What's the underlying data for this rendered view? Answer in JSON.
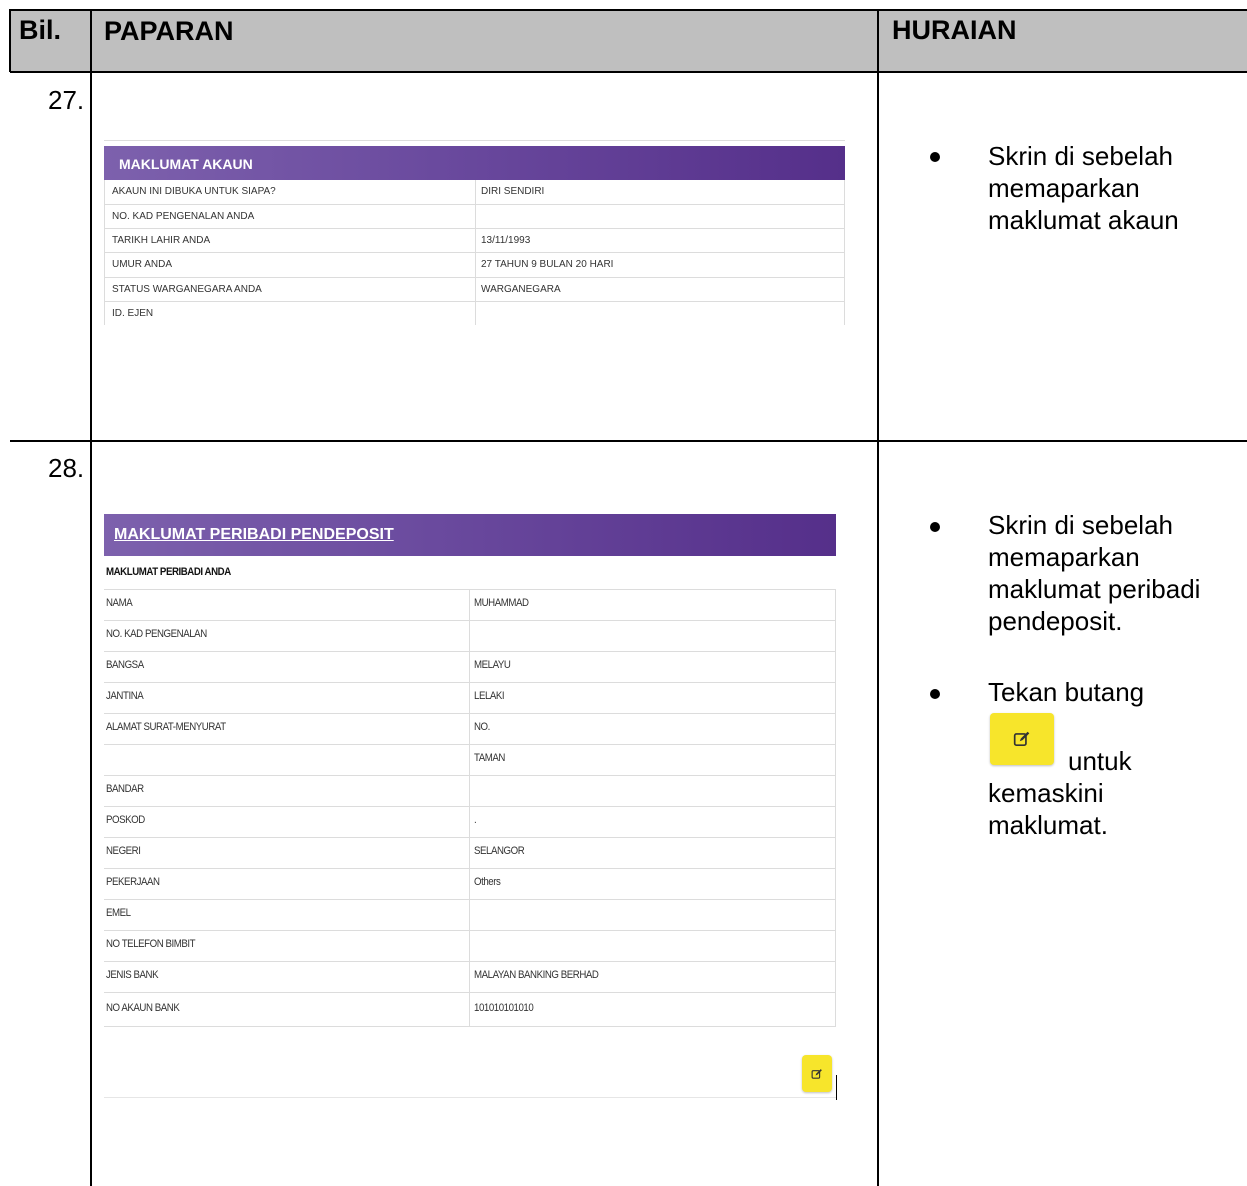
{
  "table": {
    "headers": {
      "bil": "Bil.",
      "paparan": "PAPARAN",
      "huraian": "HURAIAN"
    },
    "rows": [
      {
        "bil": "27.",
        "bullets": [
          "Skrin di sebelah memaparkan maklumat akaun"
        ],
        "panel": {
          "title": "MAKLUMAT AKAUN",
          "fields": [
            {
              "label": "AKAUN INI DIBUKA UNTUK SIAPA?",
              "value": "DIRI SENDIRI"
            },
            {
              "label": "NO. KAD PENGENALAN ANDA",
              "value": ""
            },
            {
              "label": "TARIKH LAHIR ANDA",
              "value": "13/11/1993"
            },
            {
              "label": "UMUR ANDA",
              "value": "27 TAHUN 9 BULAN 20 HARI"
            },
            {
              "label": "STATUS WARGANEGARA ANDA",
              "value": "WARGANEGARA"
            },
            {
              "label": "ID. EJEN",
              "value": ""
            }
          ]
        }
      },
      {
        "bil": "28.",
        "bullets": [
          "Skrin di sebelah memaparkan maklumat peribadi pendeposit."
        ],
        "bullet2_before": "Tekan butang",
        "bullet2_after": "untuk",
        "bullet2_tail": "kemaskini maklumat.",
        "panel": {
          "title": "MAKLUMAT PERIBADI PENDEPOSIT",
          "subtitle": "MAKLUMAT PERIBADI ANDA",
          "fields": [
            {
              "label": "NAMA",
              "value": "MUHAMMAD"
            },
            {
              "label": "NO. KAD PENGENALAN",
              "value": ""
            },
            {
              "label": "BANGSA",
              "value": "MELAYU"
            },
            {
              "label": "JANTINA",
              "value": "LELAKI"
            },
            {
              "label": "ALAMAT SURAT-MENYURAT",
              "value": "NO."
            },
            {
              "label": "",
              "value": "TAMAN"
            },
            {
              "label": "BANDAR",
              "value": ""
            },
            {
              "label": "POSKOD",
              "value": "."
            },
            {
              "label": "NEGERI",
              "value": "SELANGOR"
            },
            {
              "label": "PEKERJAAN",
              "value": "Others"
            },
            {
              "label": "EMEL",
              "value": ""
            },
            {
              "label": "NO TELEFON BIMBIT",
              "value": ""
            },
            {
              "label": "JENIS BANK",
              "value": "MALAYAN BANKING BERHAD"
            },
            {
              "label": "NO AKAUN BANK",
              "value": "101010101010"
            }
          ]
        }
      }
    ]
  },
  "icons": {
    "edit": "edit-icon"
  },
  "colors": {
    "header_bg": "#bfbfbf",
    "panel_bar": "#6a4a9e",
    "edit_button": "#f7e52b"
  }
}
